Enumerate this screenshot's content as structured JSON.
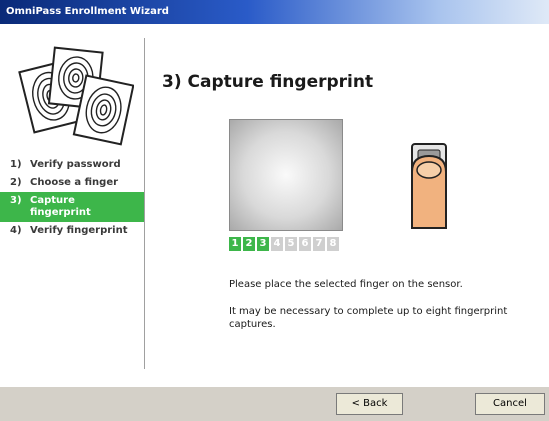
{
  "window": {
    "title": "OmniPass Enrollment Wizard"
  },
  "steps": [
    {
      "num": "1)",
      "label": "Verify password",
      "active": false
    },
    {
      "num": "2)",
      "label": "Choose a finger",
      "active": false
    },
    {
      "num": "3)",
      "label": "Capture fingerprint",
      "active": true
    },
    {
      "num": "4)",
      "label": "Verify fingerprint",
      "active": false
    }
  ],
  "main": {
    "title": "3)  Capture fingerprint",
    "captures": {
      "labels": [
        "1",
        "2",
        "3",
        "4",
        "5",
        "6",
        "7",
        "8"
      ],
      "completed": 3
    },
    "instruction": "Please place the selected finger on the sensor.",
    "note": "It may be necessary to complete up to eight fingerprint captures."
  },
  "buttons": {
    "back": "< Back",
    "cancel": "Cancel"
  },
  "colors": {
    "accent": "#3db64a",
    "title_bar": "#0a2a78"
  }
}
